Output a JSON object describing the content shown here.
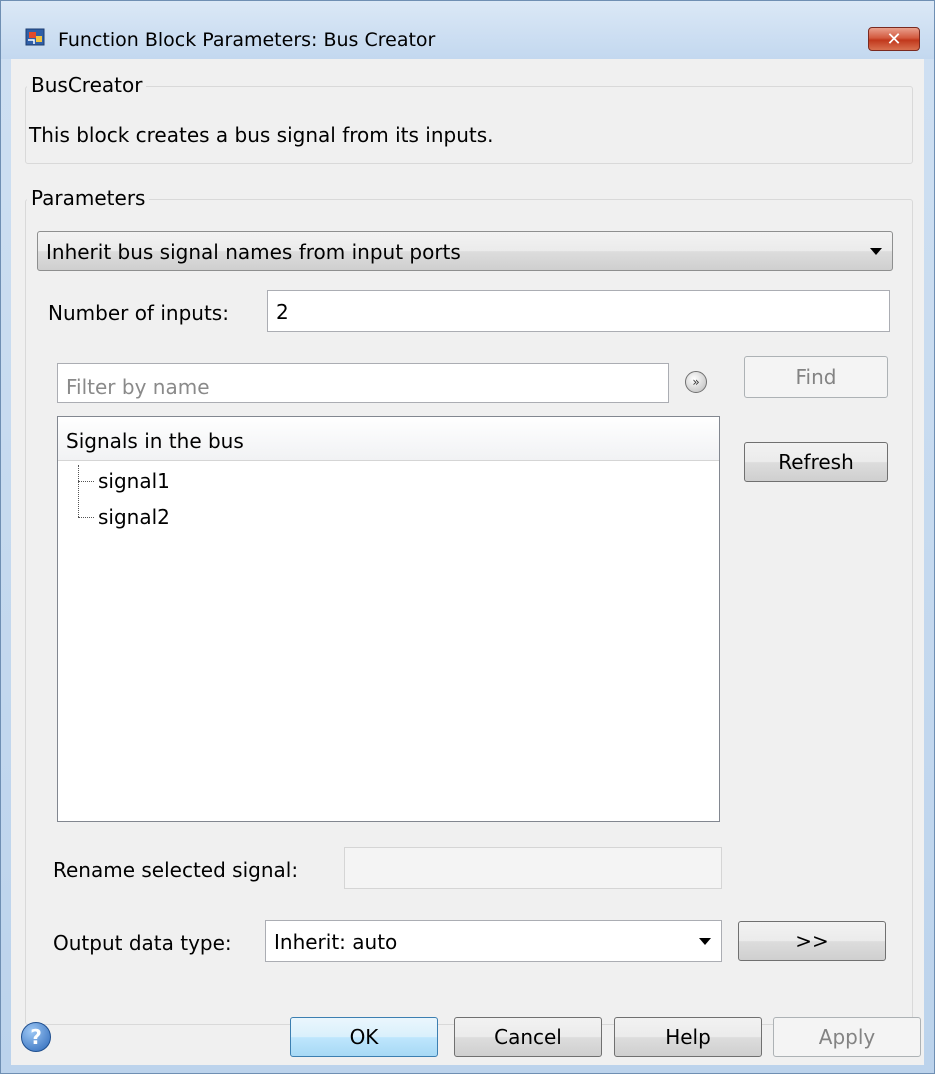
{
  "window": {
    "title": "Function Block Parameters: Bus Creator",
    "close_glyph": "✕"
  },
  "block_group": {
    "title": "BusCreator",
    "description": "This block creates a bus signal from its inputs."
  },
  "parameters_group": {
    "title": "Parameters",
    "naming_mode": "Inherit bus signal names from input ports",
    "num_inputs_label": "Number of inputs:",
    "num_inputs_value": "2",
    "filter_placeholder": "Filter by name",
    "expand_glyph": "»",
    "find_label": "Find",
    "refresh_label": "Refresh",
    "signals_header": "Signals in the bus",
    "signals": [
      "signal1",
      "signal2"
    ],
    "rename_label": "Rename selected signal:",
    "rename_value": "",
    "output_type_label": "Output data type:",
    "output_type_value": "Inherit: auto",
    "data_type_assistant_label": ">>"
  },
  "footer": {
    "help_glyph": "?",
    "ok_label": "OK",
    "cancel_label": "Cancel",
    "help_label": "Help",
    "apply_label": "Apply"
  },
  "icons": [
    "simulink-block-icon",
    "close-icon",
    "expand-filter-icon",
    "help-icon",
    "dropdown-arrow-icon"
  ]
}
